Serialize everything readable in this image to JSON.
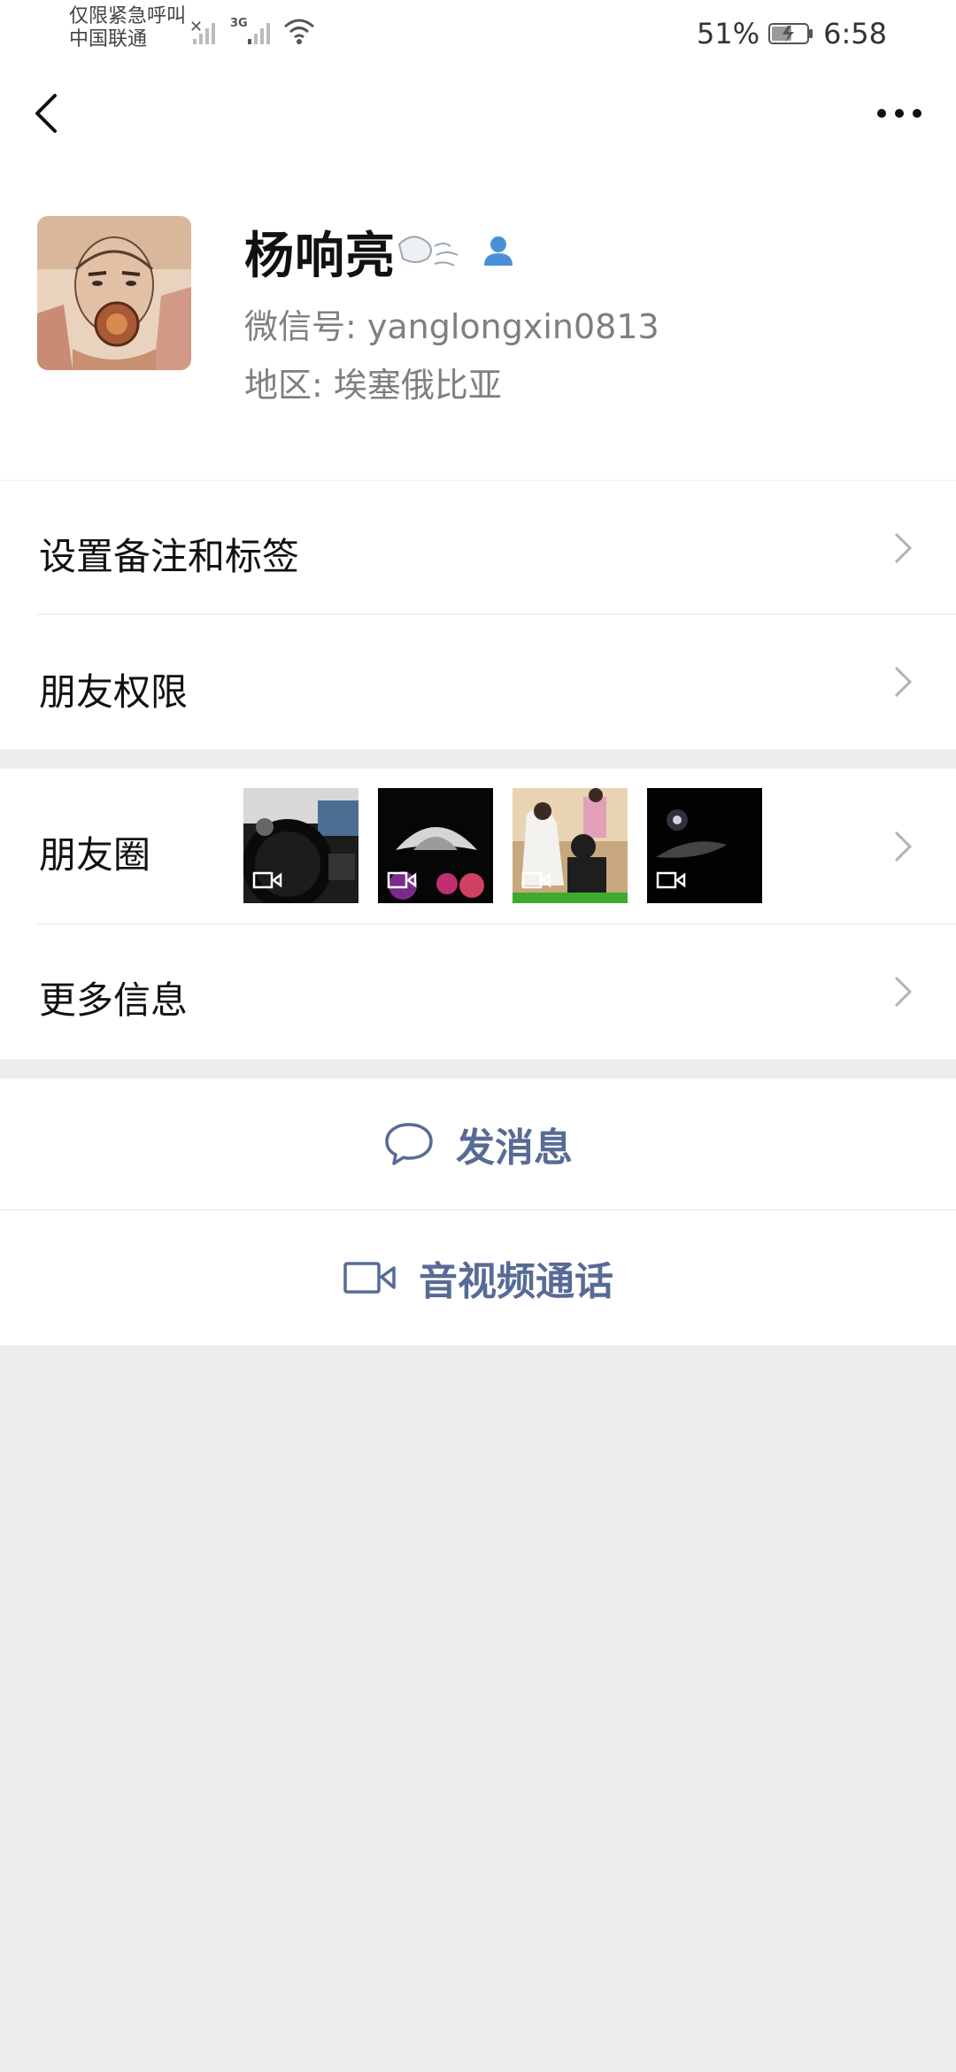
{
  "status_bar": {
    "carrier_line1": "仅限紧急呼叫",
    "carrier_line2": "中国联通",
    "network_type": "3G",
    "battery_percent": "51%",
    "time": "6:58",
    "icons": [
      "no-signal-icon",
      "signal-3g-icon",
      "wifi-icon",
      "battery-charging-icon"
    ]
  },
  "nav": {
    "back_icon": "back-chevron-icon",
    "more_icon": "more-dots-icon"
  },
  "profile": {
    "name": "杨响亮",
    "wechat_id": "微信号: yanglongxin0813",
    "region": "地区: 埃塞俄比亚",
    "badge_icon": "contact-person-icon"
  },
  "rows": {
    "remark_tags": "设置备注和标签",
    "friend_permissions": "朋友权限",
    "moments": "朋友圈",
    "more_info": "更多信息"
  },
  "moments_thumbnails": [
    {
      "name": "car-interior-video",
      "icon": "video-icon"
    },
    {
      "name": "night-road-dashboard-video",
      "icon": "video-icon"
    },
    {
      "name": "wedding-video",
      "icon": "video-icon"
    },
    {
      "name": "dark-road-video",
      "icon": "video-icon"
    }
  ],
  "actions": {
    "send_message": "发消息",
    "video_call": "音视频通话"
  },
  "colors": {
    "accent": "#576B95",
    "page_bg": "#EDEDED",
    "card_bg": "#FFFFFF",
    "secondary_text": "#7F7F7F",
    "badge_blue": "#4A90D9"
  }
}
